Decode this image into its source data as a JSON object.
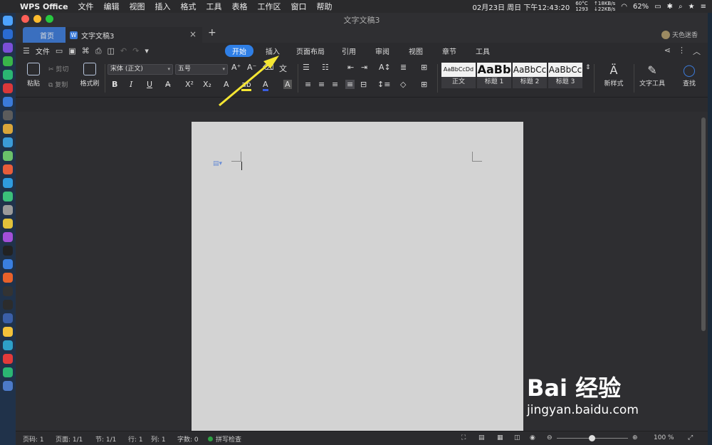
{
  "menubar": {
    "app": "WPS Office",
    "items": [
      "文件",
      "编辑",
      "视图",
      "插入",
      "格式",
      "工具",
      "表格",
      "工作区",
      "窗口",
      "帮助"
    ],
    "clock": "02月23日 周日 下午12:43:20",
    "temp": "60°C",
    "rpm": "1293",
    "net_up": "↑18KB/s",
    "net_down": "↓22KB/s",
    "battery": "62%"
  },
  "window": {
    "title": "文字文稿3"
  },
  "tabs": {
    "home": "首页",
    "doc": "文字文稿3",
    "user": "天色迷香"
  },
  "ribbon_tabs": {
    "file": "文件",
    "items": [
      "开始",
      "插入",
      "页面布局",
      "引用",
      "审阅",
      "视图",
      "章节",
      "工具"
    ]
  },
  "ribbon": {
    "paste": "粘贴",
    "cut": "剪切",
    "copy": "复制",
    "format_painter": "格式刷",
    "font": "宋体 (正文)",
    "size": "五号",
    "styles": [
      {
        "preview": "AaBbCcDd",
        "name": "正文"
      },
      {
        "preview": "AaBb",
        "name": "标题 1"
      },
      {
        "preview": "AaBbCc",
        "name": "标题 2"
      },
      {
        "preview": "AaBbCc",
        "name": "标题 3"
      }
    ],
    "new_style": "新样式",
    "text_tools": "文字工具",
    "find": "查找"
  },
  "status": {
    "page": "页码: 1",
    "pages": "页面: 1/1",
    "section": "节: 1/1",
    "row": "行: 1",
    "col": "列: 1",
    "words": "字数: 0",
    "spell": "拼写检查",
    "zoom": "100 %"
  },
  "watermark": {
    "brand": "Bai 经验",
    "url": "jingyan.baidu.com"
  },
  "colors": {
    "accent": "#2f7fe6",
    "annotation_arrow": "#f5e633"
  }
}
